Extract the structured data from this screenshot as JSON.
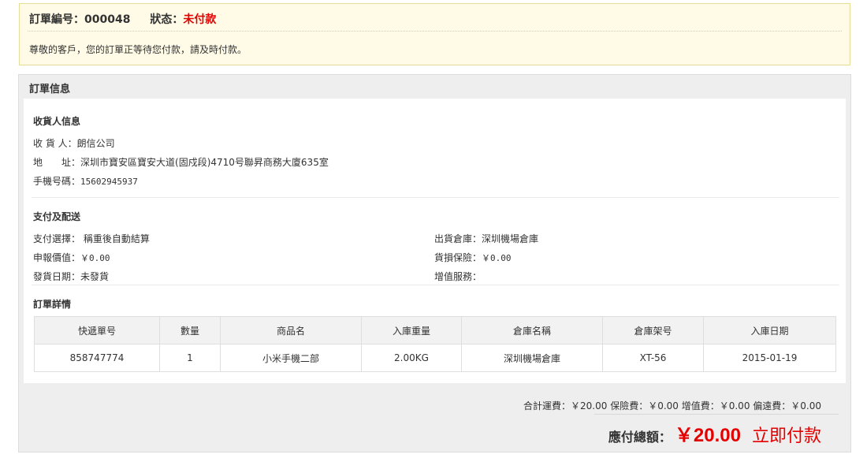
{
  "notice": {
    "order_label": "訂單編号：",
    "order_number": "000048",
    "status_label": "狀态：",
    "status_value": "未付款",
    "message": "尊敬的客戶，您的訂單正等待您付款，請及時付款。"
  },
  "panel": {
    "title": "訂單信息"
  },
  "receiver": {
    "title": "收貨人信息",
    "name_label": "收 貨 人：",
    "name_value": "朗信公司",
    "address_label": "地　　址：",
    "address_value": "深圳市寶安區寶安大道(固戍段)4710号聯昇商務大廈635室",
    "phone_label": "手機号碼：",
    "phone_value": "15602945937"
  },
  "payment": {
    "title": "支付及配送",
    "pay_method_label": "支付選擇：",
    "pay_method_value": "稱重後自動結算",
    "declared_label": "申報價值：",
    "declared_value": "￥0.00",
    "ship_date_label": "發貨日期：",
    "ship_date_value": "未發貨",
    "warehouse_label": "出貨倉庫：",
    "warehouse_value": "深圳機場倉庫",
    "insurance_label": "貨損保險：",
    "insurance_value": "￥0.00",
    "value_added_label": "增值服務：",
    "value_added_value": ""
  },
  "details": {
    "title": "訂單詳情",
    "columns": [
      "快遞單号",
      "數量",
      "商品名",
      "入庫重量",
      "倉庫名稱",
      "倉庫架号",
      "入庫日期"
    ],
    "rows": [
      [
        "858747774",
        "1",
        "小米手機二部",
        "2.00KG",
        "深圳機場倉庫",
        "XT-56",
        "2015-01-19"
      ]
    ]
  },
  "totals": {
    "fees_text": "合計運費：￥20.00 保險費：￥0.00 增值費：￥0.00 偏遠費：￥0.00",
    "total_label": "應付總額：",
    "total_value": "￥20.00",
    "pay_now_label": "立即付款"
  }
}
